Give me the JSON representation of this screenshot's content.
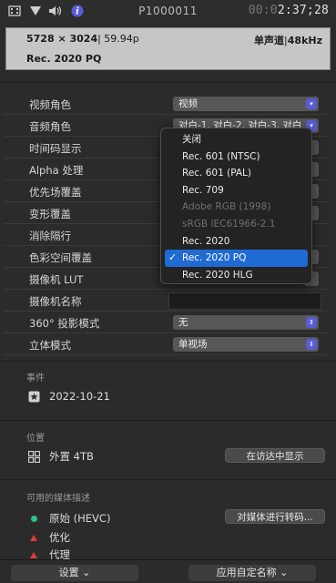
{
  "topbar": {
    "title": "P1000011",
    "timecode_dim": "00:0",
    "timecode": "2:37;28",
    "icons": [
      "filmstrip-icon",
      "filter-icon",
      "speaker-icon",
      "info-icon"
    ]
  },
  "info": {
    "resolution": "5728 × 3024",
    "framerate": "| 59.94p",
    "audio": "单声道",
    "samplerate_sep": "|",
    "samplerate": "48kHz",
    "colorspace": "Rec. 2020 PQ"
  },
  "properties": [
    {
      "label": "视频角色",
      "value": "视频",
      "type": "popup"
    },
    {
      "label": "音频角色",
      "value": "对白-1, 对白-2, 对白-3, 对白",
      "type": "popup"
    },
    {
      "label": "时间码显示",
      "value": "",
      "type": "hidden"
    },
    {
      "label": "Alpha 处理",
      "value": "",
      "type": "hidden"
    },
    {
      "label": "优先场覆盖",
      "value": "",
      "type": "hidden"
    },
    {
      "label": "变形覆盖",
      "value": "",
      "type": "hidden"
    },
    {
      "label": "消除隔行",
      "value": "",
      "type": "hidden"
    },
    {
      "label": "色彩空间覆盖",
      "value": "",
      "type": "hidden"
    },
    {
      "label": "摄像机 LUT",
      "value": "",
      "type": "hidden"
    },
    {
      "label": "摄像机名称",
      "value": "",
      "type": "text"
    },
    {
      "label": "360° 投影模式",
      "value": "无",
      "type": "popup"
    },
    {
      "label": "立体模式",
      "value": "单视场",
      "type": "popup"
    }
  ],
  "event": {
    "section_label": "事件",
    "date": "2022-10-21"
  },
  "location": {
    "section_label": "位置",
    "drive": "外置 4TB",
    "reveal_button": "在访达中显示"
  },
  "media": {
    "section_label": "可用的媒体描述",
    "original": "原始 (HEVC)",
    "optimized": "优化",
    "proxy": "代理",
    "transcode_button": "对媒体进行转码..."
  },
  "bottombar": {
    "settings_button": "设置 ⌄",
    "custom_name_button": "应用自定名称 ⌄"
  },
  "menu": {
    "items": [
      {
        "label": "关闭",
        "state": "normal"
      },
      {
        "label": "Rec. 601 (NTSC)",
        "state": "normal"
      },
      {
        "label": "Rec. 601 (PAL)",
        "state": "normal"
      },
      {
        "label": "Rec. 709",
        "state": "normal"
      },
      {
        "label": "Adobe RGB (1998)",
        "state": "disabled"
      },
      {
        "label": "sRGB IEC61966-2.1",
        "state": "disabled"
      },
      {
        "label": "Rec. 2020",
        "state": "normal"
      },
      {
        "label": "Rec. 2020 PQ",
        "state": "selected"
      },
      {
        "label": "Rec. 2020 HLG",
        "state": "normal"
      }
    ],
    "check_mark": "✓"
  },
  "colors": {
    "accent": "#5b5bd6",
    "selection": "#1f6ad4",
    "ok_green": "#2ec27e",
    "warn_red": "#e0393e"
  }
}
